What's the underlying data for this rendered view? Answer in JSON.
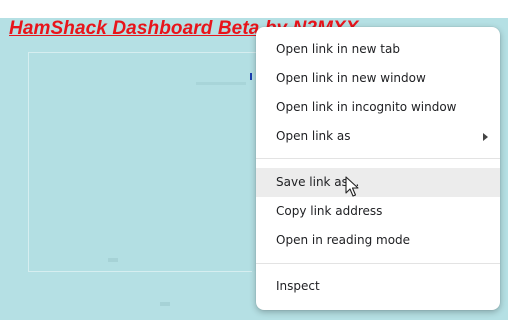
{
  "page": {
    "title": "HamShack Dashboard Beta by N2MXX",
    "title_color": "#e8141b",
    "background_color": "#b5e0e4"
  },
  "context_menu": {
    "items": [
      {
        "label": "Open link in new tab"
      },
      {
        "label": "Open link in new window"
      },
      {
        "label": "Open link in incognito window"
      },
      {
        "label": "Open link as",
        "submenu": true
      },
      {
        "label": "Save link as...",
        "hovered": true
      },
      {
        "label": "Copy link address"
      },
      {
        "label": "Open in reading mode"
      },
      {
        "label": "Inspect"
      }
    ],
    "icons": {
      "submenu_arrow": "chevron-right-icon",
      "cursor": "mouse-pointer-icon"
    }
  }
}
